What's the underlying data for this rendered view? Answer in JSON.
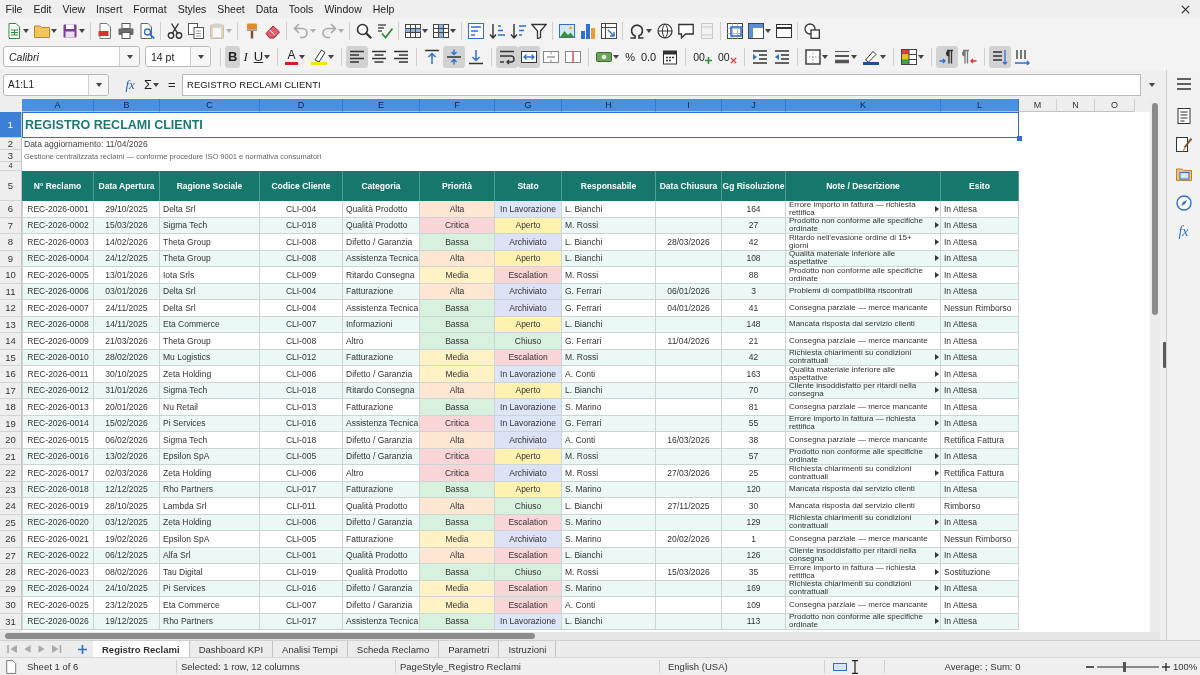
{
  "menu_bar": [
    "File",
    "Edit",
    "View",
    "Insert",
    "Format",
    "Styles",
    "Sheet",
    "Data",
    "Tools",
    "Window",
    "Help"
  ],
  "standard_toolbar": [
    [
      {
        "kind": "new",
        "disabled": false
      },
      {
        "kind": "open",
        "disabled": false
      },
      {
        "kind": "save",
        "disabled": false
      }
    ],
    [
      {
        "kind": "export_pdf",
        "disabled": false
      },
      {
        "kind": "print",
        "disabled": false
      },
      {
        "kind": "print_preview",
        "disabled": false
      }
    ],
    [
      {
        "kind": "cut",
        "disabled": false
      },
      {
        "kind": "copy",
        "disabled": false
      },
      {
        "kind": "paste",
        "disabled": true
      }
    ],
    [
      {
        "kind": "clone_formatting",
        "disabled": false
      },
      {
        "kind": "clear_formatting",
        "disabled": false
      }
    ],
    [
      {
        "kind": "undo",
        "disabled": true
      },
      {
        "kind": "redo",
        "disabled": true
      }
    ],
    [
      {
        "kind": "find",
        "disabled": false
      },
      {
        "kind": "spelling",
        "disabled": false
      }
    ],
    [
      {
        "kind": "rows",
        "disabled": false
      },
      {
        "kind": "columns",
        "disabled": false
      }
    ],
    [
      {
        "kind": "sort",
        "disabled": false
      },
      {
        "kind": "sort_ascending",
        "disabled": false
      },
      {
        "kind": "sort_descending",
        "disabled": false
      },
      {
        "kind": "autofilter",
        "disabled": false
      }
    ],
    [
      {
        "kind": "image",
        "disabled": false
      },
      {
        "kind": "chart",
        "disabled": false
      },
      {
        "kind": "pivot_table",
        "disabled": false
      }
    ],
    [
      {
        "kind": "special_character",
        "disabled": false
      },
      {
        "kind": "hyperlink",
        "disabled": false
      },
      {
        "kind": "comment",
        "disabled": false
      },
      {
        "kind": "headers_footers",
        "disabled": true
      }
    ],
    [
      {
        "kind": "print_area",
        "disabled": false
      },
      {
        "kind": "freeze",
        "disabled": false
      },
      {
        "kind": "split",
        "disabled": false
      }
    ],
    [
      {
        "kind": "shapes",
        "disabled": false
      }
    ]
  ],
  "format_toolbar": {
    "font_name": "Calibri",
    "font_size": "14 pt",
    "groups": [
      [
        {
          "kind": "bold",
          "label": "B",
          "pressed": true
        },
        {
          "kind": "italic",
          "label": "I",
          "pressed": false
        },
        {
          "kind": "underline",
          "label": "U",
          "pressed": false
        }
      ],
      [
        {
          "kind": "font_color",
          "label": "A",
          "pressed": false
        },
        {
          "kind": "highlight",
          "pressed": false
        }
      ],
      [
        {
          "kind": "align_left",
          "pressed": true
        },
        {
          "kind": "align_center",
          "pressed": false
        },
        {
          "kind": "align_right",
          "pressed": false
        }
      ],
      [
        {
          "kind": "align_top",
          "pressed": false
        },
        {
          "kind": "align_middle",
          "pressed": true
        },
        {
          "kind": "align_bottom",
          "pressed": false
        }
      ],
      [
        {
          "kind": "wrap",
          "pressed": true
        },
        {
          "kind": "merge_center",
          "pressed": true
        },
        {
          "kind": "merge",
          "pressed": false
        },
        {
          "kind": "unmerge",
          "pressed": false
        }
      ],
      [
        {
          "kind": "currency",
          "pressed": false
        },
        {
          "kind": "percent",
          "label": "%",
          "pressed": false
        },
        {
          "kind": "number",
          "label": "0.0",
          "pressed": false
        },
        {
          "kind": "date",
          "pressed": false
        }
      ],
      [
        {
          "kind": "add_decimal",
          "label": "00",
          "pressed": false
        },
        {
          "kind": "delete_decimal",
          "label": "00",
          "pressed": false
        }
      ],
      [
        {
          "kind": "indent_increase",
          "pressed": false
        },
        {
          "kind": "indent_decrease",
          "pressed": false
        }
      ],
      [
        {
          "kind": "borders",
          "pressed": false
        },
        {
          "kind": "border_style",
          "pressed": false
        },
        {
          "kind": "border_color",
          "pressed": false
        }
      ],
      [
        {
          "kind": "conditional",
          "pressed": false
        }
      ],
      [
        {
          "kind": "ltr",
          "pressed": true
        },
        {
          "kind": "rtl",
          "pressed": false
        }
      ],
      [
        {
          "kind": "text_horizontal",
          "pressed": true
        },
        {
          "kind": "text_vertical",
          "pressed": false
        }
      ]
    ]
  },
  "formula_bar": {
    "name_box": "A1:L1",
    "function_wizard": "fx",
    "sum": "Σ",
    "equals": "=",
    "content": "REGISTRO RECLAMI CLIENTI"
  },
  "sheet": {
    "columns": [
      {
        "label": "A",
        "selected": true
      },
      {
        "label": "B",
        "selected": true
      },
      {
        "label": "C",
        "selected": true
      },
      {
        "label": "D",
        "selected": true
      },
      {
        "label": "E",
        "selected": true
      },
      {
        "label": "F",
        "selected": true
      },
      {
        "label": "G",
        "selected": true
      },
      {
        "label": "H",
        "selected": true
      },
      {
        "label": "I",
        "selected": true
      },
      {
        "label": "J",
        "selected": true
      },
      {
        "label": "K",
        "selected": true
      },
      {
        "label": "L",
        "selected": true
      },
      {
        "label": "M",
        "selected": false
      },
      {
        "label": "N",
        "selected": false
      },
      {
        "label": "O",
        "selected": false
      }
    ],
    "row_headers": [
      {
        "label": "1",
        "selected": true
      },
      {
        "label": "2",
        "selected": false
      },
      {
        "label": "3",
        "selected": false
      },
      {
        "label": "4",
        "selected": false
      },
      {
        "label": "5",
        "selected": false
      },
      {
        "label": "6",
        "selected": false
      },
      {
        "label": "7",
        "selected": false
      },
      {
        "label": "8",
        "selected": false
      },
      {
        "label": "9",
        "selected": false
      },
      {
        "label": "10",
        "selected": false
      },
      {
        "label": "11",
        "selected": false
      },
      {
        "label": "12",
        "selected": false
      },
      {
        "label": "13",
        "selected": false
      },
      {
        "label": "14",
        "selected": false
      },
      {
        "label": "15",
        "selected": false
      },
      {
        "label": "16",
        "selected": false
      },
      {
        "label": "17",
        "selected": false
      },
      {
        "label": "18",
        "selected": false
      },
      {
        "label": "19",
        "selected": false
      },
      {
        "label": "20",
        "selected": false
      },
      {
        "label": "21",
        "selected": false
      },
      {
        "label": "22",
        "selected": false
      },
      {
        "label": "23",
        "selected": false
      },
      {
        "label": "24",
        "selected": false
      },
      {
        "label": "25",
        "selected": false
      },
      {
        "label": "26",
        "selected": false
      },
      {
        "label": "27",
        "selected": false
      },
      {
        "label": "28",
        "selected": false
      },
      {
        "label": "29",
        "selected": false
      },
      {
        "label": "30",
        "selected": false
      },
      {
        "label": "31",
        "selected": false
      }
    ],
    "title": "REGISTRO RECLAMI CLIENTI",
    "updated": "Data aggiornamento: 11/04/2026",
    "subtitle": "Gestione centralizzata reclami — conforme procedure ISO 9001 e normativa consumatori",
    "table": {
      "headers": [
        "N° Reclamo",
        "Data Apertura",
        "Ragione Sociale",
        "Codice Cliente",
        "Categoria",
        "Priorità",
        "Stato",
        "Responsabile",
        "Data Chiusura",
        "Gg Risoluzione",
        "Note / Descrizione",
        "Esito"
      ],
      "rows": [
        {
          "id": "REC-2026-0001",
          "opened": "29/10/2025",
          "company": "Delta Srl",
          "client": "CLI-004",
          "category": "Qualità Prodotto",
          "priority": {
            "text": "Alta",
            "color": "#fde6d2"
          },
          "status": {
            "text": "In Lavorazione",
            "color": "#dce6f8"
          },
          "owner": "L. Bianchi",
          "days": "164",
          "note": "Errore importo in fattura — richiesta rettifica",
          "overflow": true,
          "outcome": "In Attesa"
        },
        {
          "id": "REC-2026-0002",
          "opened": "15/03/2026",
          "company": "Sigma Tech",
          "client": "CLI-018",
          "category": "Qualità Prodotto",
          "priority": {
            "text": "Critica",
            "color": "#fad6d9"
          },
          "status": {
            "text": "Aperto",
            "color": "#fff1b0"
          },
          "owner": "M. Rossi",
          "days": "27",
          "note": "Prodotto non conforme alle specifiche ordinate",
          "overflow": true,
          "outcome": "In Attesa"
        },
        {
          "id": "REC-2026-0003",
          "opened": "14/02/2026",
          "company": "Theta Group",
          "client": "CLI-008",
          "category": "Difetto / Garanzia",
          "priority": {
            "text": "Bassa",
            "color": "#d8f1de"
          },
          "status": {
            "text": "Archiviato",
            "color": "#dde2f6"
          },
          "owner": "L. Bianchi",
          "closed": "28/03/2026",
          "days": "42",
          "note": "Ritardo nell'evasione ordine di 15+ giorni",
          "overflow": true,
          "outcome": "In Attesa"
        },
        {
          "id": "REC-2026-0004",
          "opened": "24/12/2025",
          "company": "Theta Group",
          "client": "CLI-008",
          "category": "Assistenza Tecnica",
          "priority": {
            "text": "Alta",
            "color": "#fde6d2"
          },
          "status": {
            "text": "Aperto",
            "color": "#fff1b0"
          },
          "owner": "L. Bianchi",
          "days": "108",
          "note": "Qualità materiale inferiore alle aspettative",
          "overflow": true,
          "outcome": "In Attesa"
        },
        {
          "id": "REC-2026-0005",
          "opened": "13/01/2026",
          "company": "Iota Srls",
          "client": "CLI-009",
          "category": "Ritardo Consegna",
          "priority": {
            "text": "Media",
            "color": "#fff3c6"
          },
          "status": {
            "text": "Escalation",
            "color": "#fad6d9"
          },
          "owner": "M. Rossi",
          "days": "88",
          "note": "Prodotto non conforme alle specifiche ordinate",
          "overflow": true,
          "outcome": "In Attesa"
        },
        {
          "id": "REC-2026-0006",
          "opened": "03/01/2026",
          "company": "Delta Srl",
          "client": "CLI-004",
          "category": "Fatturazione",
          "priority": {
            "text": "Alta",
            "color": "#fde6d2"
          },
          "status": {
            "text": "Archiviato",
            "color": "#dde2f6"
          },
          "owner": "G. Ferrari",
          "closed": "06/01/2026",
          "days": "3",
          "note": "Problemi di compatibilità riscontrati",
          "overflow": false,
          "outcome": "In Attesa"
        },
        {
          "id": "REC-2026-0007",
          "opened": "24/11/2025",
          "company": "Delta Srl",
          "client": "CLI-004",
          "category": "Assistenza Tecnica",
          "priority": {
            "text": "Bassa",
            "color": "#d8f1de"
          },
          "status": {
            "text": "Archiviato",
            "color": "#dde2f6"
          },
          "owner": "G. Ferrari",
          "closed": "04/01/2026",
          "days": "41",
          "note": "Consegna parziale — merce mancante",
          "overflow": false,
          "outcome": "Nessun Rimborso"
        },
        {
          "id": "REC-2026-0008",
          "opened": "14/11/2025",
          "company": "Eta Commerce",
          "client": "CLI-007",
          "category": "Informazioni",
          "priority": {
            "text": "Bassa",
            "color": "#d8f1de"
          },
          "status": {
            "text": "Aperto",
            "color": "#fff1b0"
          },
          "owner": "L. Bianchi",
          "days": "148",
          "note": "Mancata risposta dal servizio clienti",
          "overflow": false,
          "outcome": "In Attesa"
        },
        {
          "id": "REC-2026-0009",
          "opened": "21/03/2026",
          "company": "Theta Group",
          "client": "CLI-008",
          "category": "Altro",
          "priority": {
            "text": "Bassa",
            "color": "#d8f1de"
          },
          "status": {
            "text": "Chiuso",
            "color": "#d8f1de"
          },
          "owner": "G. Ferrari",
          "closed": "11/04/2026",
          "days": "21",
          "note": "Consegna parziale — merce mancante",
          "overflow": false,
          "outcome": "In Attesa"
        },
        {
          "id": "REC-2026-0010",
          "opened": "28/02/2026",
          "company": "Mu Logistics",
          "client": "CLI-012",
          "category": "Fatturazione",
          "priority": {
            "text": "Media",
            "color": "#fff3c6"
          },
          "status": {
            "text": "Escalation",
            "color": "#fad6d9"
          },
          "owner": "M. Rossi",
          "days": "42",
          "note": "Richiesta chiarimenti su condizioni contrattuali",
          "overflow": true,
          "outcome": "In Attesa"
        },
        {
          "id": "REC-2026-0011",
          "opened": "30/10/2025",
          "company": "Zeta Holding",
          "client": "CLI-006",
          "category": "Difetto / Garanzia",
          "priority": {
            "text": "Media",
            "color": "#fff3c6"
          },
          "status": {
            "text": "In Lavorazione",
            "color": "#dce6f8"
          },
          "owner": "A. Conti",
          "days": "163",
          "note": "Qualità materiale inferiore alle aspettative",
          "overflow": true,
          "outcome": "In Attesa"
        },
        {
          "id": "REC-2026-0012",
          "opened": "31/01/2026",
          "company": "Sigma Tech",
          "client": "CLI-018",
          "category": "Ritardo Consegna",
          "priority": {
            "text": "Alta",
            "color": "#fde6d2"
          },
          "status": {
            "text": "Aperto",
            "color": "#fff1b0"
          },
          "owner": "L. Bianchi",
          "days": "70",
          "note": "Cliente insoddisfatto per ritardi nella consegna",
          "overflow": true,
          "outcome": "In Attesa"
        },
        {
          "id": "REC-2026-0013",
          "opened": "20/01/2026",
          "company": "Nu Retail",
          "client": "CLI-013",
          "category": "Fatturazione",
          "priority": {
            "text": "Bassa",
            "color": "#d8f1de"
          },
          "status": {
            "text": "In Lavorazione",
            "color": "#dce6f8"
          },
          "owner": "S. Marino",
          "days": "81",
          "note": "Consegna parziale — merce mancante",
          "overflow": false,
          "outcome": "In Attesa"
        },
        {
          "id": "REC-2026-0014",
          "opened": "15/02/2026",
          "company": "Pi Services",
          "client": "CLI-016",
          "category": "Assistenza Tecnica",
          "priority": {
            "text": "Critica",
            "color": "#fad6d9"
          },
          "status": {
            "text": "In Lavorazione",
            "color": "#dce6f8"
          },
          "owner": "G. Ferrari",
          "days": "55",
          "note": "Errore importo in fattura — richiesta rettifica",
          "overflow": true,
          "outcome": "In Attesa"
        },
        {
          "id": "REC-2026-0015",
          "opened": "06/02/2026",
          "company": "Sigma Tech",
          "client": "CLI-018",
          "category": "Difetto / Garanzia",
          "priority": {
            "text": "Alta",
            "color": "#fde6d2"
          },
          "status": {
            "text": "Archiviato",
            "color": "#dde2f6"
          },
          "owner": "A. Conti",
          "closed": "16/03/2026",
          "days": "38",
          "note": "Consegna parziale — merce mancante",
          "overflow": false,
          "outcome": "Rettifica Fattura"
        },
        {
          "id": "REC-2026-0016",
          "opened": "13/02/2026",
          "company": "Epsilon SpA",
          "client": "CLI-005",
          "category": "Difetto / Garanzia",
          "priority": {
            "text": "Critica",
            "color": "#fad6d9"
          },
          "status": {
            "text": "Aperto",
            "color": "#fff1b0"
          },
          "owner": "M. Rossi",
          "days": "57",
          "note": "Prodotto non conforme alle specifiche ordinate",
          "overflow": true,
          "outcome": "In Attesa"
        },
        {
          "id": "REC-2026-0017",
          "opened": "02/03/2026",
          "company": "Zeta Holding",
          "client": "CLI-006",
          "category": "Altro",
          "priority": {
            "text": "Critica",
            "color": "#fad6d9"
          },
          "status": {
            "text": "Archiviato",
            "color": "#dde2f6"
          },
          "owner": "M. Rossi",
          "closed": "27/03/2026",
          "days": "25",
          "note": "Richiesta chiarimenti su condizioni contrattuali",
          "overflow": true,
          "outcome": "Rettifica Fattura"
        },
        {
          "id": "REC-2026-0018",
          "opened": "12/12/2025",
          "company": "Rho Partners",
          "client": "CLI-017",
          "category": "Fatturazione",
          "priority": {
            "text": "Bassa",
            "color": "#d8f1de"
          },
          "status": {
            "text": "Aperto",
            "color": "#fff1b0"
          },
          "owner": "S. Marino",
          "days": "120",
          "note": "Mancata risposta dal servizio clienti",
          "overflow": false,
          "outcome": "In Attesa"
        },
        {
          "id": "REC-2026-0019",
          "opened": "28/10/2025",
          "company": "Lambda Srl",
          "client": "CLI-011",
          "category": "Qualità Prodotto",
          "priority": {
            "text": "Alta",
            "color": "#fde6d2"
          },
          "status": {
            "text": "Chiuso",
            "color": "#d8f1de"
          },
          "owner": "L. Bianchi",
          "closed": "27/11/2025",
          "days": "30",
          "note": "Mancata risposta dal servizio clienti",
          "overflow": false,
          "outcome": "Rimborso"
        },
        {
          "id": "REC-2026-0020",
          "opened": "03/12/2025",
          "company": "Zeta Holding",
          "client": "CLI-006",
          "category": "Difetto / Garanzia",
          "priority": {
            "text": "Bassa",
            "color": "#d8f1de"
          },
          "status": {
            "text": "Escalation",
            "color": "#fad6d9"
          },
          "owner": "S. Marino",
          "days": "129",
          "note": "Richiesta chiarimenti su condizioni contrattuali",
          "overflow": true,
          "outcome": "In Attesa"
        },
        {
          "id": "REC-2026-0021",
          "opened": "19/02/2026",
          "company": "Epsilon SpA",
          "client": "CLI-005",
          "category": "Fatturazione",
          "priority": {
            "text": "Media",
            "color": "#fff3c6"
          },
          "status": {
            "text": "Archiviato",
            "color": "#dde2f6"
          },
          "owner": "S. Marino",
          "closed": "20/02/2026",
          "days": "1",
          "note": "Consegna parziale — merce mancante",
          "overflow": false,
          "outcome": "Nessun Rimborso"
        },
        {
          "id": "REC-2026-0022",
          "opened": "06/12/2025",
          "company": "Alfa Srl",
          "client": "CLI-001",
          "category": "Qualità Prodotto",
          "priority": {
            "text": "Alta",
            "color": "#fde6d2"
          },
          "status": {
            "text": "Escalation",
            "color": "#fad6d9"
          },
          "owner": "L. Bianchi",
          "days": "126",
          "note": "Cliente insoddisfatto per ritardi nella consegna",
          "overflow": true,
          "outcome": "In Attesa"
        },
        {
          "id": "REC-2026-0023",
          "opened": "08/02/2026",
          "company": "Tau Digital",
          "client": "CLI-019",
          "category": "Qualità Prodotto",
          "priority": {
            "text": "Bassa",
            "color": "#d8f1de"
          },
          "status": {
            "text": "Chiuso",
            "color": "#d8f1de"
          },
          "owner": "M. Rossi",
          "closed": "15/03/2026",
          "days": "35",
          "note": "Errore importo in fattura — richiesta rettifica",
          "overflow": true,
          "outcome": "Sostituzione"
        },
        {
          "id": "REC-2026-0024",
          "opened": "24/10/2025",
          "company": "Pi Services",
          "client": "CLI-016",
          "category": "Difetto / Garanzia",
          "priority": {
            "text": "Media",
            "color": "#fff3c6"
          },
          "status": {
            "text": "Escalation",
            "color": "#fad6d9"
          },
          "owner": "S. Marino",
          "days": "169",
          "note": "Richiesta chiarimenti su condizioni contrattuali",
          "overflow": true,
          "outcome": "In Attesa"
        },
        {
          "id": "REC-2026-0025",
          "opened": "23/12/2025",
          "company": "Eta Commerce",
          "client": "CLI-007",
          "category": "Difetto / Garanzia",
          "priority": {
            "text": "Media",
            "color": "#fff3c6"
          },
          "status": {
            "text": "Escalation",
            "color": "#fad6d9"
          },
          "owner": "A. Conti",
          "days": "109",
          "note": "Consegna parziale — merce mancante",
          "overflow": false,
          "outcome": "In Attesa"
        },
        {
          "id": "REC-2026-0026",
          "opened": "19/12/2025",
          "company": "Rho Partners",
          "client": "CLI-017",
          "category": "Assistenza Tecnica",
          "priority": {
            "text": "Bassa",
            "color": "#d8f1de"
          },
          "status": {
            "text": "In Lavorazione",
            "color": "#dce6f8"
          },
          "owner": "L. Bianchi",
          "days": "113",
          "note": "Prodotto non conforme alle specifiche ordinate",
          "overflow": true,
          "outcome": "In Attesa"
        }
      ]
    }
  },
  "sidebar": [
    {
      "kind": "menu"
    },
    {
      "kind": "properties"
    },
    {
      "kind": "styles"
    },
    {
      "kind": "gallery"
    },
    {
      "kind": "navigator"
    },
    {
      "kind": "functions",
      "label": "fx"
    }
  ],
  "sheet_tabs": [
    {
      "label": "Registro Reclami",
      "selected": true
    },
    {
      "label": "Dashboard KPI",
      "selected": false
    },
    {
      "label": "Analisi Tempi",
      "selected": false
    },
    {
      "label": "Scheda Reclamo",
      "selected": false
    },
    {
      "label": "Parametri",
      "selected": false
    },
    {
      "label": "Istruzioni",
      "selected": false
    }
  ],
  "status_bar": {
    "sheet": "Sheet 1 of 6",
    "selection": "Selected: 1 row, 12 columns",
    "page_style": "PageStyle_Registro Reclami",
    "language": "English (USA)",
    "summary": "Average: ; Sum: 0",
    "zoom": {
      "level": 0.45,
      "reading": "100%"
    }
  }
}
